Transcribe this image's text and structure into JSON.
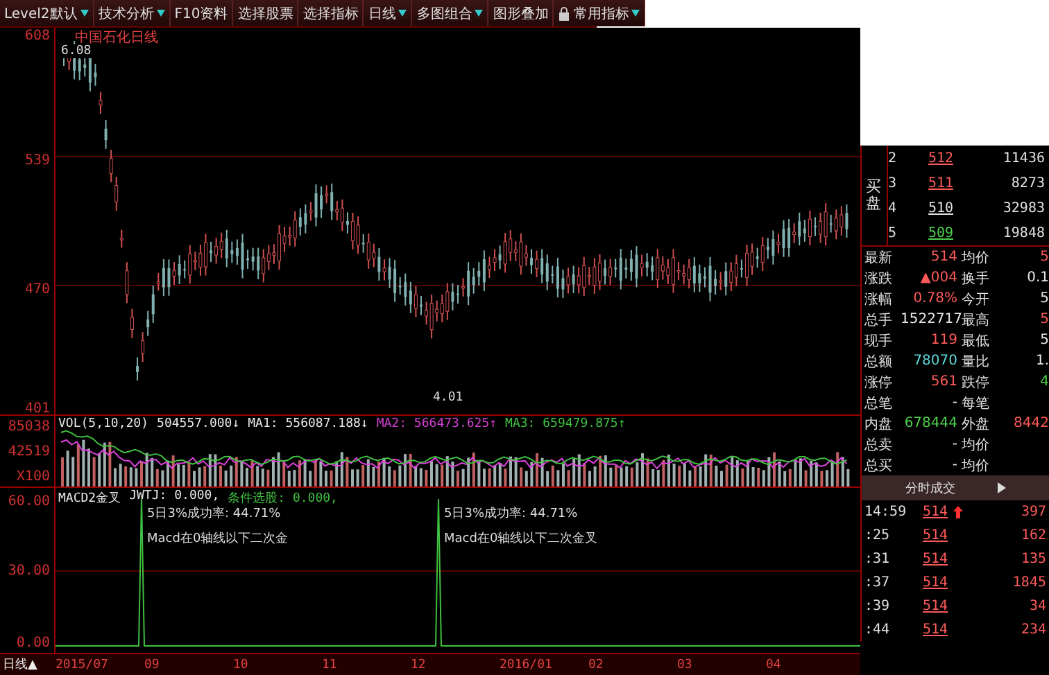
{
  "toolbar": [
    {
      "label": "Level2默认",
      "dropdown": true,
      "lock": false
    },
    {
      "label": "技术分析",
      "dropdown": true,
      "lock": false
    },
    {
      "label": "F10资料",
      "dropdown": false,
      "lock": false
    },
    {
      "label": "选择股票",
      "dropdown": false,
      "lock": false
    },
    {
      "label": "选择指标",
      "dropdown": false,
      "lock": false
    },
    {
      "label": "日线",
      "dropdown": true,
      "lock": false
    },
    {
      "label": "多图组合",
      "dropdown": true,
      "lock": false
    },
    {
      "label": "图形叠加",
      "dropdown": false,
      "lock": false
    },
    {
      "label": "常用指标",
      "dropdown": true,
      "lock": true
    }
  ],
  "price_chart": {
    "title": "中国石化日线",
    "high_label": "6.08",
    "low_label": "4.01",
    "axis": [
      "608",
      "539",
      "470",
      "401"
    ]
  },
  "volume_chart": {
    "axis": [
      "85038",
      "42519",
      "X100"
    ],
    "legend": [
      {
        "text": "VOL(5,10,20)",
        "color": "#e8e8e8"
      },
      {
        "text": "504557.000↓",
        "color": "#e8e8e8"
      },
      {
        "text": "MA1: 556087.188↓",
        "color": "#e8e8e8"
      },
      {
        "text": "MA2: 566473.625↑",
        "color": "#d040d0"
      },
      {
        "text": "MA3: 659479.875↑",
        "color": "#40c040"
      }
    ]
  },
  "macd_chart": {
    "axis": [
      "60.00",
      "30.00",
      "0.00"
    ],
    "legend": [
      {
        "text": "MACD2金叉",
        "color": "#e8e8e8"
      },
      {
        "text": "JWTJ: 0.000,",
        "color": "#e8e8e8"
      },
      {
        "text": "条件选股: 0.000,",
        "color": "#40c040"
      }
    ],
    "signals": [
      {
        "rate": "5日3%成功率: 44.71%",
        "note": "Macd在0轴线以下二次金"
      },
      {
        "rate": "5日3%成功率: 44.71%",
        "note": "Macd在0轴线以下二次金叉"
      }
    ]
  },
  "date_axis": {
    "period": "日线▲",
    "dates": [
      "2015/07",
      "09",
      "10",
      "11",
      "12",
      "2016/01",
      "02",
      "03",
      "04"
    ]
  },
  "order_book": {
    "side_label": "买盘",
    "rows": [
      {
        "level": "2",
        "price": "512",
        "volume": "11436",
        "color": "#ff5a5a"
      },
      {
        "level": "3",
        "price": "511",
        "volume": "8273",
        "color": "#ff5a5a"
      },
      {
        "level": "4",
        "price": "510",
        "volume": "32983",
        "color": "#e0e0e0"
      },
      {
        "level": "5",
        "price": "509",
        "volume": "19848",
        "color": "#4cd04c"
      }
    ]
  },
  "quote": [
    [
      {
        "label": "最新",
        "value": "514",
        "color": "#ff5a5a"
      },
      {
        "label": "均价",
        "value": "5",
        "color": "#ff5a5a"
      }
    ],
    [
      {
        "label": "涨跌",
        "value": "▲004",
        "color": "#ff5a5a"
      },
      {
        "label": "换手",
        "value": "0.1",
        "color": "#e8e8e8"
      }
    ],
    [
      {
        "label": "涨幅",
        "value": "0.78%",
        "color": "#ff5a5a"
      },
      {
        "label": "今开",
        "value": "5",
        "color": "#e8e8e8"
      }
    ],
    [
      {
        "label": "总手",
        "value": "1522717",
        "color": "#e8e8e8"
      },
      {
        "label": "最高",
        "value": "5",
        "color": "#ff5a5a"
      }
    ],
    [
      {
        "label": "现手",
        "value": "119",
        "color": "#ff5a5a"
      },
      {
        "label": "最低",
        "value": "5",
        "color": "#e8e8e8"
      }
    ],
    [
      {
        "label": "总额",
        "value": "78070",
        "color": "#5fd8d8"
      },
      {
        "label": "量比",
        "value": "1.",
        "color": "#e8e8e8"
      }
    ],
    [
      {
        "label": "涨停",
        "value": "561",
        "color": "#ff5a5a"
      },
      {
        "label": "跌停",
        "value": "4",
        "color": "#4cd04c"
      }
    ],
    [
      {
        "label": "总笔",
        "value": "-",
        "color": "#e8e8e8"
      },
      {
        "label": "每笔"
      }
    ],
    [
      {
        "label": "内盘",
        "value": "678444",
        "color": "#4cd04c"
      },
      {
        "label": "外盘",
        "value": "8442",
        "color": "#ff5a5a"
      }
    ],
    [
      {
        "label": "总卖",
        "value": "-",
        "color": "#e8e8e8"
      },
      {
        "label": "均价"
      }
    ],
    [
      {
        "label": "总买",
        "value": "-",
        "color": "#e8e8e8"
      },
      {
        "label": "均价"
      }
    ]
  ],
  "ticks": {
    "title": "分时成交",
    "rows": [
      {
        "time": "14:59",
        "price": "514",
        "volume": "397",
        "arrow": true
      },
      {
        "time": ":25",
        "price": "514",
        "volume": "162",
        "arrow": false
      },
      {
        "time": ":31",
        "price": "514",
        "volume": "135",
        "arrow": false
      },
      {
        "time": ":37",
        "price": "514",
        "volume": "1845",
        "arrow": false
      },
      {
        "time": ":39",
        "price": "514",
        "volume": "34",
        "arrow": false
      },
      {
        "time": ":44",
        "price": "514",
        "volume": "234",
        "arrow": false
      }
    ]
  }
}
